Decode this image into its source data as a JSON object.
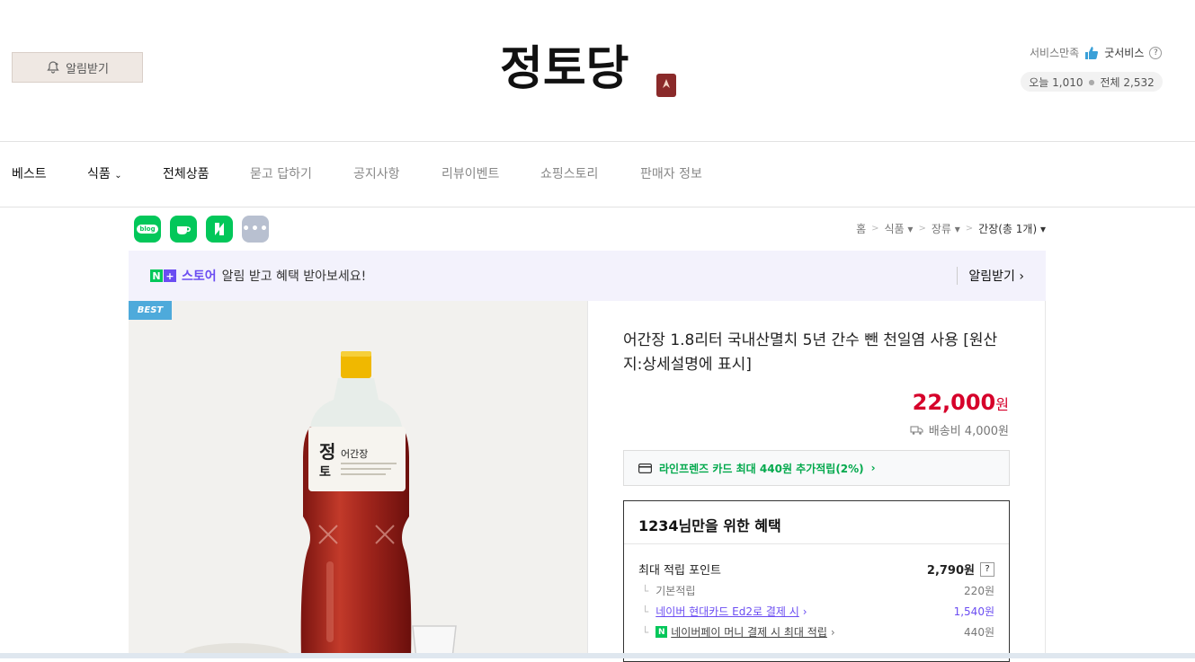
{
  "header": {
    "alarm_label": "알림받기",
    "logo_text": "정토당",
    "service_label": "서비스만족",
    "service_value": "굿서비스",
    "visits_today": "오늘 1,010",
    "visits_total": "전체 2,532"
  },
  "nav": {
    "items": [
      {
        "label": "베스트"
      },
      {
        "label": "식품"
      },
      {
        "label": "전체상품"
      },
      {
        "label": "묻고 답하기"
      },
      {
        "label": "공지사항"
      },
      {
        "label": "리뷰이벤트"
      },
      {
        "label": "쇼핑스토리"
      },
      {
        "label": "판매자 정보"
      }
    ]
  },
  "social": {
    "blog": "blog"
  },
  "breadcrumb": {
    "items": [
      "홈",
      "식품",
      "장류"
    ],
    "current": "간장(총 1개)"
  },
  "store_banner": {
    "brand": "스토어",
    "message": "알림 받고 혜택 받아보세요!",
    "action": "알림받기"
  },
  "product": {
    "badge": "BEST",
    "label_text": "어간장",
    "title": "어간장 1.8리터 국내산멸치 5년 간수 뺀 천일염 사용 [원산지:상세설명에 표시]",
    "price": "22,000",
    "price_unit": "원",
    "shipping": "배송비 4,000원",
    "card_promo": "라인프렌즈 카드 최대 440원 추가적립(2%)"
  },
  "benefit": {
    "title": "1234님만을 위한 혜택",
    "max_points_label": "최대 적립 포인트",
    "max_points_value": "2,790원",
    "rows": [
      {
        "label": "기본적립",
        "value": "220원"
      },
      {
        "label": "네이버 현대카드 Ed2로 결제 시",
        "value": "1,540원"
      },
      {
        "label": "네이버페이 머니 결제 시 최대 적립",
        "value": "440원"
      }
    ]
  },
  "colors": {
    "price_red": "#d6002a",
    "naver_green": "#03c75a",
    "store_purple": "#6b4df2"
  }
}
